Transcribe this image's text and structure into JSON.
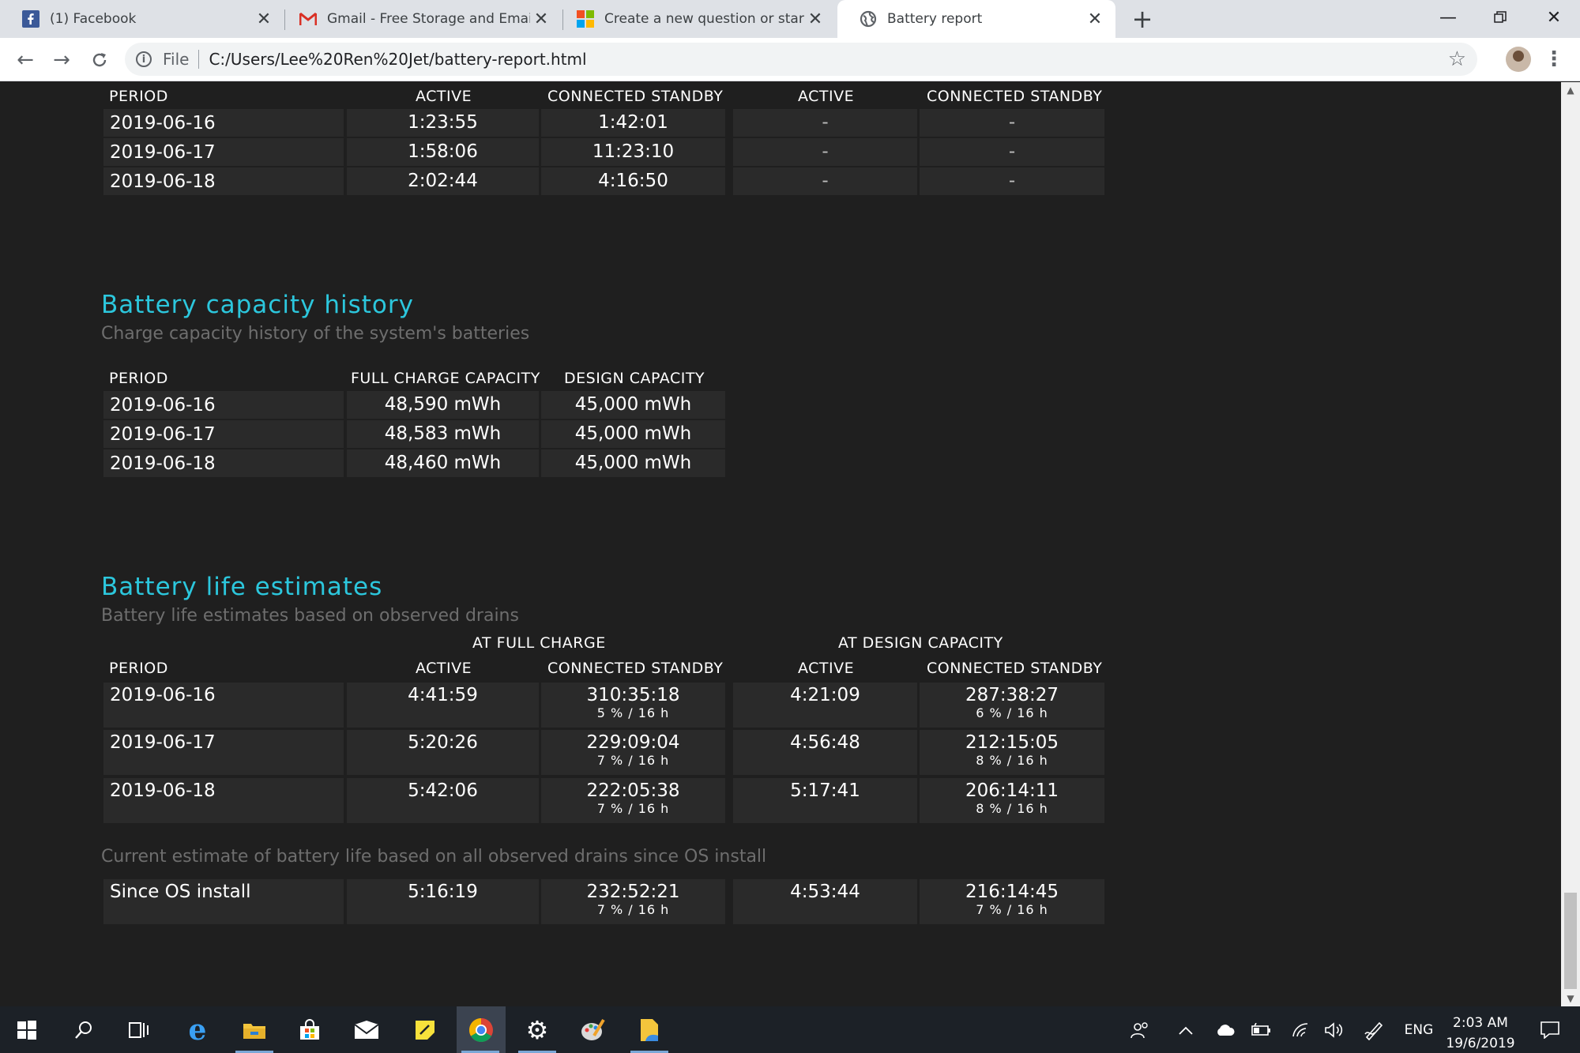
{
  "browser": {
    "tabs": [
      {
        "title": "(1) Facebook",
        "icon": "facebook-icon"
      },
      {
        "title": "Gmail - Free Storage and Email fr",
        "icon": "gmail-icon"
      },
      {
        "title": "Create a new question or start a",
        "icon": "microsoft-icon"
      },
      {
        "title": "Battery report",
        "icon": "globe-icon"
      }
    ],
    "address": {
      "scheme": "File",
      "url": "C:/Users/Lee%20Ren%20Jet/battery-report.html"
    }
  },
  "usage_table": {
    "headers": [
      "PERIOD",
      "ACTIVE",
      "CONNECTED STANDBY",
      "ACTIVE",
      "CONNECTED STANDBY"
    ],
    "rows": [
      {
        "period": "2019-06-16",
        "active": "1:23:55",
        "standby": "1:42:01",
        "active2": "-",
        "standby2": "-"
      },
      {
        "period": "2019-06-17",
        "active": "1:58:06",
        "standby": "11:23:10",
        "active2": "-",
        "standby2": "-"
      },
      {
        "period": "2019-06-18",
        "active": "2:02:44",
        "standby": "4:16:50",
        "active2": "-",
        "standby2": "-"
      }
    ]
  },
  "capacity": {
    "title": "Battery capacity history",
    "subtitle": "Charge capacity history of the system's batteries",
    "headers": [
      "PERIOD",
      "FULL CHARGE CAPACITY",
      "DESIGN CAPACITY"
    ],
    "rows": [
      {
        "period": "2019-06-16",
        "full": "48,590 mWh",
        "design": "45,000 mWh"
      },
      {
        "period": "2019-06-17",
        "full": "48,583 mWh",
        "design": "45,000 mWh"
      },
      {
        "period": "2019-06-18",
        "full": "48,460 mWh",
        "design": "45,000 mWh"
      }
    ]
  },
  "estimates": {
    "title": "Battery life estimates",
    "subtitle": "Battery life estimates based on observed drains",
    "group_full": "AT FULL CHARGE",
    "group_design": "AT DESIGN CAPACITY",
    "headers": [
      "PERIOD",
      "ACTIVE",
      "CONNECTED STANDBY",
      "ACTIVE",
      "CONNECTED STANDBY"
    ],
    "rows": [
      {
        "period": "2019-06-16",
        "active": "4:41:59",
        "standby": "310:35:18",
        "standby_sub": "5 % / 16 h",
        "active2": "4:21:09",
        "standby2": "287:38:27",
        "standby2_sub": "6 % / 16 h"
      },
      {
        "period": "2019-06-17",
        "active": "5:20:26",
        "standby": "229:09:04",
        "standby_sub": "7 % / 16 h",
        "active2": "4:56:48",
        "standby2": "212:15:05",
        "standby2_sub": "8 % / 16 h"
      },
      {
        "period": "2019-06-18",
        "active": "5:42:06",
        "standby": "222:05:38",
        "standby_sub": "7 % / 16 h",
        "active2": "5:17:41",
        "standby2": "206:14:11",
        "standby2_sub": "8 % / 16 h"
      }
    ],
    "os_caption": "Current estimate of battery life based on all observed drains since OS install",
    "os_row": {
      "period": "Since OS install",
      "active": "5:16:19",
      "standby": "232:52:21",
      "standby_sub": "7 % / 16 h",
      "active2": "4:53:44",
      "standby2": "216:14:45",
      "standby2_sub": "7 % / 16 h"
    }
  },
  "taskbar": {
    "language": "ENG",
    "time": "2:03 AM",
    "date": "19/6/2019"
  }
}
